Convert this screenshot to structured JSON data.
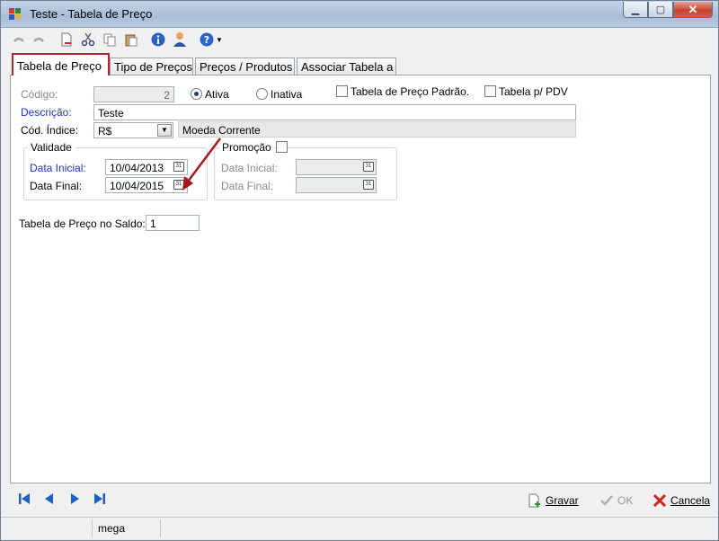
{
  "window": {
    "title": "Teste -  Tabela de Preço"
  },
  "tabs": [
    {
      "label": "Tabela de Preço"
    },
    {
      "label": "Tipo de Preços"
    },
    {
      "label": "Preços / Produtos"
    },
    {
      "label": "Associar Tabela a"
    }
  ],
  "form": {
    "codigo_label": "Código:",
    "codigo_value": "2",
    "ativa_label": "Ativa",
    "inativa_label": "Inativa",
    "padrao_label": "Tabela de Preço Padrão.",
    "pdv_label": "Tabela p/ PDV",
    "descricao_label": "Descrição:",
    "descricao_value": "Teste",
    "indice_label": "Cód. Índice:",
    "indice_value": "R$",
    "indice_desc": "Moeda Corrente",
    "validade_title": "Validade",
    "data_inicial_label": "Data Inicial:",
    "data_inicial_value": "10/04/2013",
    "data_final_label": "Data Final:",
    "data_final_value": "10/04/2015",
    "promocao_title": "Promoção",
    "promo_inicial_label": "Data Inicial:",
    "promo_final_label": "Data Final:",
    "saldo_label": "Tabela de Preço no Saldo:",
    "saldo_value": "1"
  },
  "actions": {
    "gravar": "Gravar",
    "ok": "OK",
    "cancela": "Cancela"
  },
  "status": {
    "user": "mega"
  },
  "colors": {
    "highlight": "#b3262b",
    "arrow": "#a5181e",
    "link_label": "#2233cc"
  },
  "icons": [
    "undo-icon",
    "redo-icon",
    "new-icon",
    "cut-icon",
    "copy-icon",
    "paste-icon",
    "info-icon",
    "user-icon",
    "help-icon",
    "calendar-icon",
    "first-icon",
    "prev-icon",
    "next-icon",
    "last-icon",
    "save-icon",
    "ok-check-icon",
    "cancel-x-icon"
  ]
}
